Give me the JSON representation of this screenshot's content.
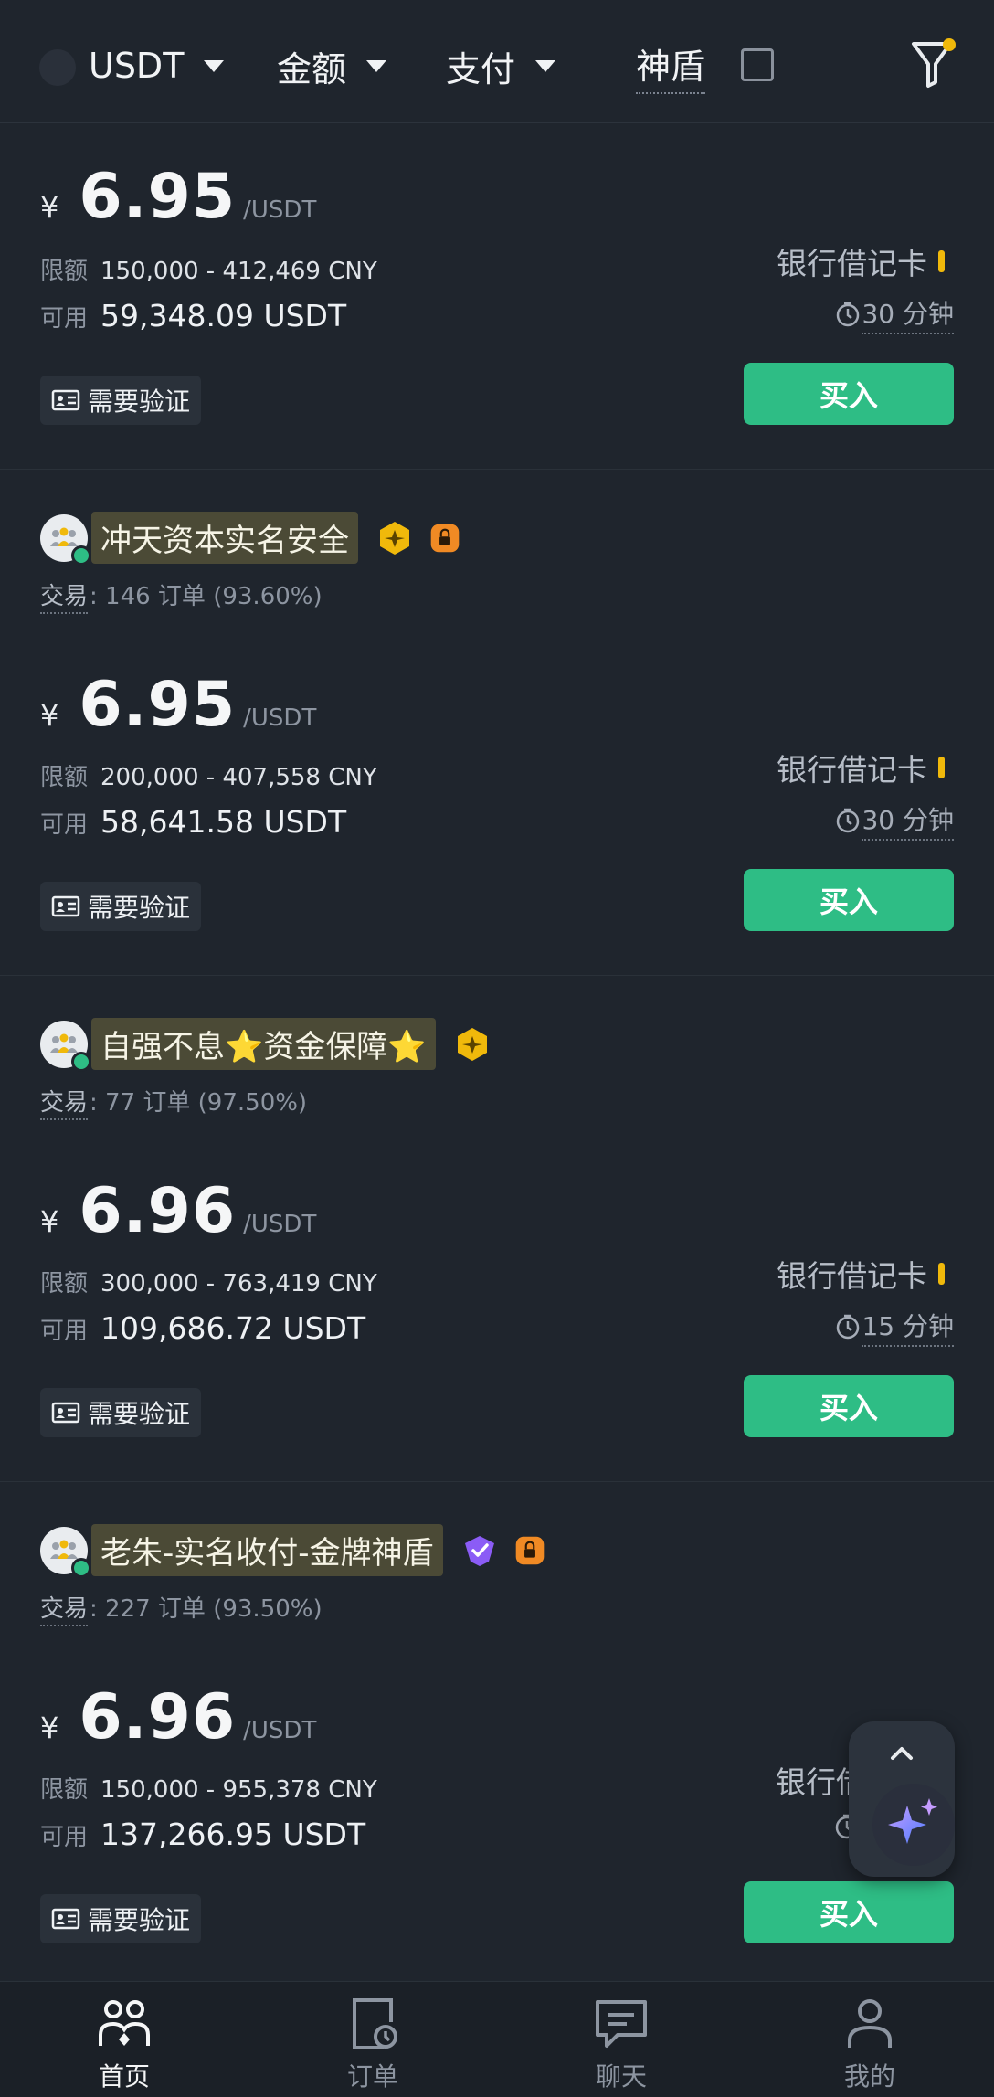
{
  "filters": {
    "coin": "USDT",
    "amount": "金额",
    "payment": "支付",
    "shield": "神盾"
  },
  "common": {
    "yen": "¥",
    "unit": "/USDT",
    "limit_label": "限额",
    "avail_label": "可用",
    "pay_method": "银行借记卡",
    "verify": "需要验证",
    "buy": "买入",
    "trade_label": "交易"
  },
  "cards": [
    {
      "price": "6.95",
      "limit": "150,000 - 412,469 CNY",
      "available": "59,348.09 USDT",
      "time": "30 分钟"
    },
    {
      "name": "冲天资本实名安全",
      "badges": [
        "gold-hexagon-badge",
        "orange-lock-badge"
      ],
      "trade": ": 146 订单  (93.60%)",
      "price": "6.95",
      "limit": "200,000 - 407,558 CNY",
      "available": "58,641.58 USDT",
      "time": "30 分钟"
    },
    {
      "name": "自强不息⭐资金保障⭐",
      "badges": [
        "gold-hexagon-badge"
      ],
      "trade": ": 77 订单  (97.50%)",
      "price": "6.96",
      "limit": "300,000 - 763,419 CNY",
      "available": "109,686.72 USDT",
      "time": "15 分钟"
    },
    {
      "name": "老朱-实名收付-金牌神盾",
      "badges": [
        "purple-shield-badge",
        "orange-lock-badge"
      ],
      "trade": ": 227 订单  (93.50%)",
      "price": "6.96",
      "limit": "150,000 - 955,378 CNY",
      "available": "137,266.95 USDT",
      "pay_method_partial": "银行借"
    }
  ],
  "nav": {
    "home": "首页",
    "orders": "订单",
    "chat": "聊天",
    "me": "我的"
  },
  "colors": {
    "background": "#1f252d",
    "buy_green": "#2ebd85",
    "accent_yellow": "#f0b90b",
    "name_highlight": "#4b4a36"
  }
}
